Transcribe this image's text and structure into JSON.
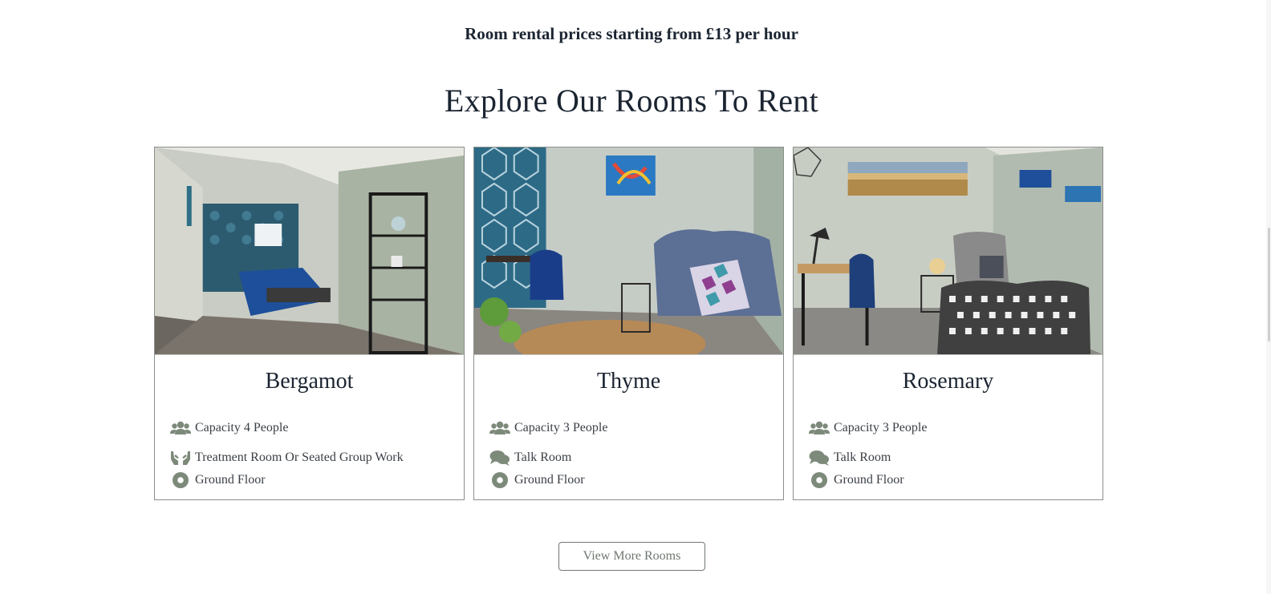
{
  "pricing": {
    "text": "Room rental prices starting from £13 per hour"
  },
  "section": {
    "title": "Explore Our Rooms To Rent"
  },
  "rooms": [
    {
      "name": "Bergamot",
      "capacity": "Capacity 4 People",
      "use": "Treatment Room Or Seated Group Work",
      "use_icon": "hands-icon",
      "floor": "Ground Floor"
    },
    {
      "name": "Thyme",
      "capacity": "Capacity 3 People",
      "use": "Talk Room",
      "use_icon": "chat-icon",
      "floor": "Ground Floor"
    },
    {
      "name": "Rosemary",
      "capacity": "Capacity 3 People",
      "use": "Talk Room",
      "use_icon": "chat-icon",
      "floor": "Ground Floor"
    }
  ],
  "cta": {
    "label": "View More Rooms"
  },
  "colors": {
    "icon": "#7d8a7a",
    "text": "#1b2431",
    "border": "#8a8f8a"
  }
}
